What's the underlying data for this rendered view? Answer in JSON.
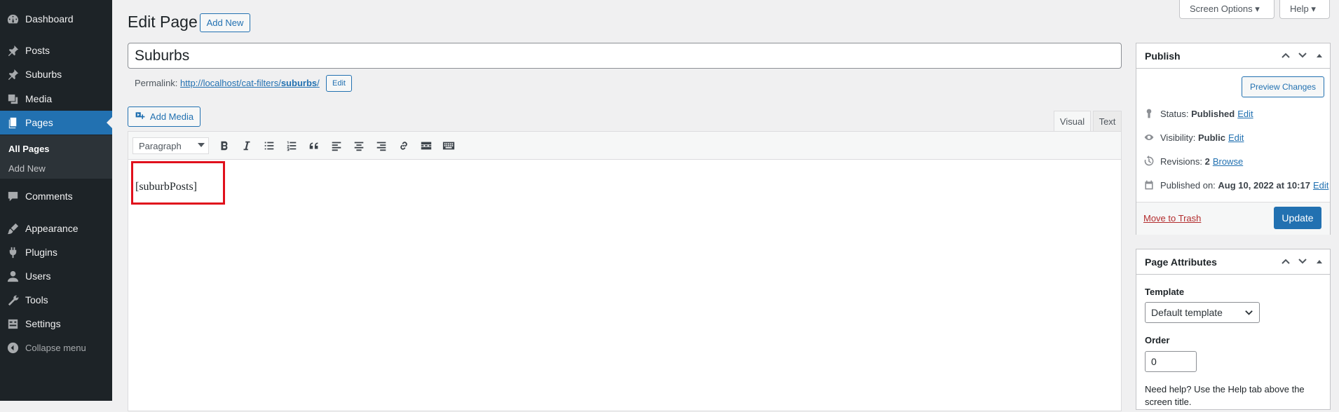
{
  "sidebar": {
    "dashboard": "Dashboard",
    "posts": "Posts",
    "suburbs": "Suburbs",
    "media": "Media",
    "pages": "Pages",
    "all_pages": "All Pages",
    "add_new": "Add New",
    "comments": "Comments",
    "appearance": "Appearance",
    "plugins": "Plugins",
    "users": "Users",
    "tools": "Tools",
    "settings": "Settings",
    "collapse": "Collapse menu"
  },
  "screen_options": "Screen Options ▾",
  "help": "Help ▾",
  "heading": "Edit Page",
  "add_new_btn": "Add New",
  "title_value": "Suburbs",
  "permalink": {
    "label": "Permalink:",
    "url": "http://localhost/cat-filters/",
    "slug": "suburbs",
    "slash": "/",
    "edit": "Edit"
  },
  "add_media": "Add Media",
  "tabs": {
    "visual": "Visual",
    "text": "Text"
  },
  "format_select": "Paragraph",
  "content": "[suburbPosts]",
  "publish": {
    "title": "Publish",
    "preview": "Preview Changes",
    "status_label": "Status:",
    "status": "Published",
    "visibility_label": "Visibility:",
    "visibility": "Public",
    "revisions_label": "Revisions:",
    "revisions": "2",
    "browse": "Browse",
    "published_on_label": "Published on:",
    "published_on": "Aug 10, 2022 at 10:17",
    "edit": "Edit",
    "trash": "Move to Trash",
    "update": "Update"
  },
  "attributes": {
    "title": "Page Attributes",
    "template_label": "Template",
    "template_value": "Default template",
    "order_label": "Order",
    "order_value": "0",
    "help": "Need help? Use the Help tab above the",
    "help2": "screen title."
  },
  "colors": {
    "admin_bg": "#1d2327",
    "accent": "#2271b1",
    "highlight": "#e0101c"
  }
}
